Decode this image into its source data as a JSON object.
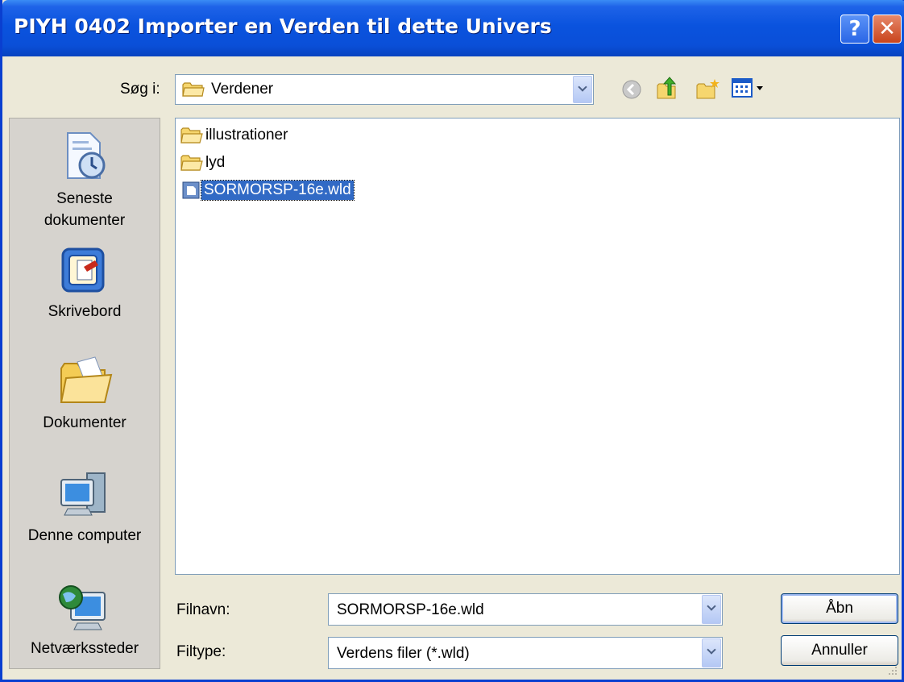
{
  "window": {
    "title": "PIYH 0402 Importer en Verden til dette Univers"
  },
  "title_buttons": {
    "help": "?",
    "close": "✕"
  },
  "lookin": {
    "label": "Søg i:",
    "value": "Verdener"
  },
  "toolbar": {
    "icons": [
      "back-icon",
      "up-folder-icon",
      "new-folder-icon",
      "view-menu-icon"
    ]
  },
  "places": [
    {
      "label_line1": "Seneste",
      "label_line2": "dokumenter",
      "icon": "recent-documents-icon"
    },
    {
      "label_line1": "Skrivebord",
      "label_line2": "",
      "icon": "desktop-icon"
    },
    {
      "label_line1": "Dokumenter",
      "label_line2": "",
      "icon": "my-documents-icon"
    },
    {
      "label_line1": "Denne computer",
      "label_line2": "",
      "icon": "my-computer-icon"
    },
    {
      "label_line1": "Netværkssteder",
      "label_line2": "",
      "icon": "network-places-icon"
    }
  ],
  "files": [
    {
      "name": "illustrationer",
      "type": "folder"
    },
    {
      "name": "lyd",
      "type": "folder"
    },
    {
      "name": "SORMORSP-16e.wld",
      "type": "file",
      "selected": true
    }
  ],
  "filename": {
    "label": "Filnavn:",
    "value": "SORMORSP-16e.wld"
  },
  "filetype": {
    "label": "Filtype:",
    "value": "Verdens filer (*.wld)"
  },
  "buttons": {
    "open": "Åbn",
    "cancel": "Annuller"
  },
  "colors": {
    "titlebar": "#0A53DE",
    "selection": "#316AC5",
    "dialog_bg": "#ECE9D8"
  }
}
